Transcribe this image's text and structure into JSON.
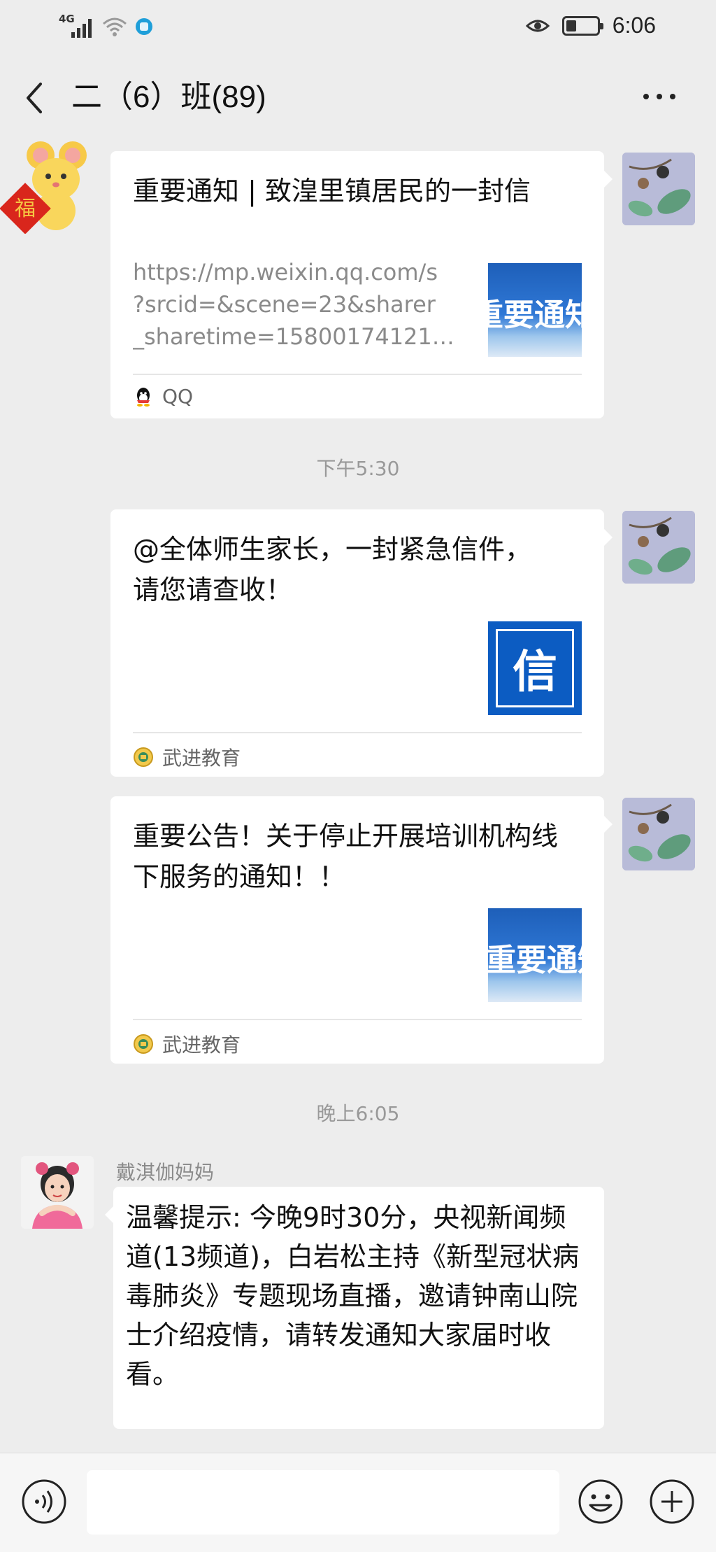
{
  "status_bar": {
    "network": "4G",
    "time": "6:06"
  },
  "title_bar": {
    "title": "二（6）班(89)"
  },
  "messages": [
    {
      "type": "link-card",
      "title": "重要通知 | 致湟里镇居民的一封信",
      "desc_lines": [
        "https://mp.weixin.qq.com/s",
        "?srcid=&scene=23&sharer",
        "_sharetime=15800174121…"
      ],
      "thumb_text": "重要通知",
      "source": "QQ"
    },
    {
      "type": "time-divider",
      "text": "下午5:30"
    },
    {
      "type": "link-card",
      "title": "@全体师生家长，一封紧急信件，请您请查收！",
      "thumb_text": "信",
      "source": "武进教育"
    },
    {
      "type": "link-card",
      "title": "重要公告！关于停止开展培训机构线下服务的通知！！",
      "thumb_text": "重要通知",
      "source": "武进教育"
    },
    {
      "type": "time-divider",
      "text": "晚上6:05"
    },
    {
      "type": "text",
      "sender": "戴淇伽妈妈",
      "text": "温馨提示: 今晚9时30分，央视新闻频道(13频道)，白岩松主持《新型冠状病毒肺炎》专题现场直播，邀请钟南山院士介绍疫情，请转发通知大家届时收看。"
    }
  ],
  "colors": {
    "background": "#ededed",
    "bubble": "#ffffff",
    "thumb_blue": "#0c5cc2"
  },
  "icons": [
    "back-icon",
    "more-icon",
    "qq-icon",
    "school-logo-icon",
    "voice-icon",
    "emoji-icon",
    "add-icon"
  ]
}
